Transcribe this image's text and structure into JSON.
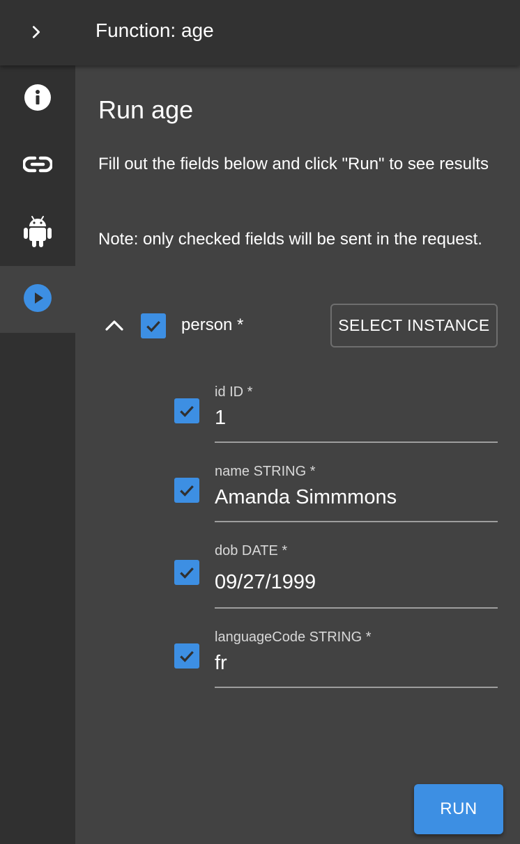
{
  "header": {
    "title": "Function: age",
    "expand_icon": "chevron-right-icon"
  },
  "sidebar": {
    "items": [
      {
        "name": "info",
        "icon": "info-icon",
        "active": false
      },
      {
        "name": "link",
        "icon": "link-icon",
        "active": false
      },
      {
        "name": "android",
        "icon": "android-icon",
        "active": false
      },
      {
        "name": "run",
        "icon": "play-circle-icon",
        "active": true
      }
    ]
  },
  "main": {
    "heading": "Run age",
    "instructions": "Fill out the fields below and click \"Run\" to see results",
    "note": "Note: only checked fields will be sent in the request.",
    "parameter": {
      "label": "person *",
      "checked": true,
      "expanded": true,
      "select_instance_label": "SELECT INSTANCE"
    },
    "fields": [
      {
        "label": "id ID *",
        "value": "1",
        "checked": true
      },
      {
        "label": "name STRING *",
        "value": "Amanda Simmmons",
        "checked": true
      },
      {
        "label": "dob DATE *",
        "value": "09/27/1999",
        "checked": true
      },
      {
        "label": "languageCode STRING *",
        "value": "fr",
        "checked": true
      }
    ],
    "run_label": "RUN"
  },
  "colors": {
    "accent": "#3d8fe3",
    "background": "#424242",
    "topbar": "#323232",
    "sidebar": "#303030"
  }
}
